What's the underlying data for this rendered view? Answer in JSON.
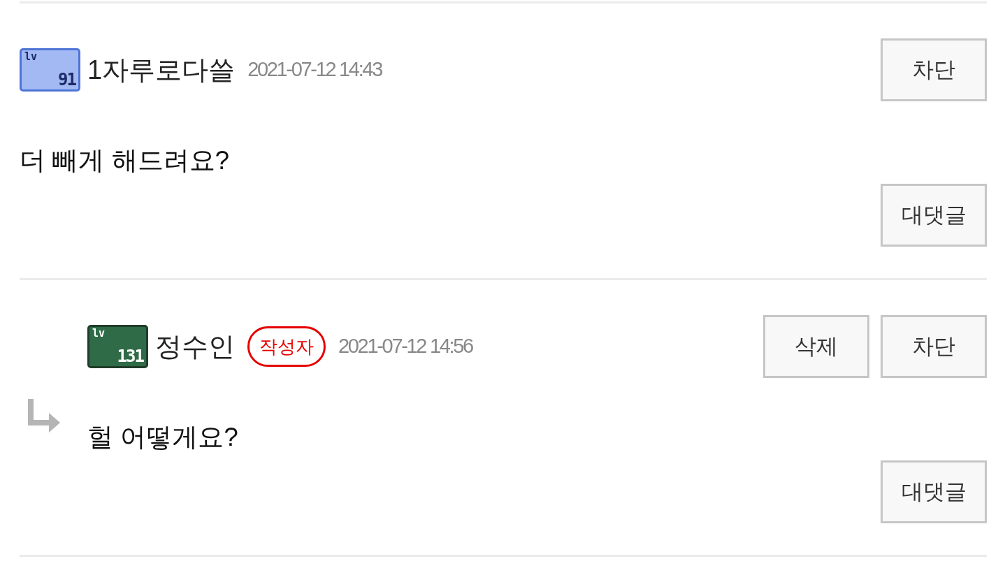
{
  "comments": [
    {
      "level_badge": {
        "prefix": "lv",
        "number": "91",
        "color": "#a3b9f4"
      },
      "name": "1자루로다쓸",
      "date": "2021-07-12 14:43",
      "actions": [
        "차단"
      ],
      "text": "더 빼게 해드려요?",
      "reply_button": "대댓글",
      "children": [
        {
          "level_badge": {
            "prefix": "lv",
            "number": "131",
            "color": "#2f6b47"
          },
          "name": "정수인",
          "author_tag": "작성자",
          "date": "2021-07-12 14:56",
          "actions": [
            "삭제",
            "차단"
          ],
          "text": "헐 어떻게요?",
          "reply_button": "대댓글"
        }
      ]
    }
  ]
}
